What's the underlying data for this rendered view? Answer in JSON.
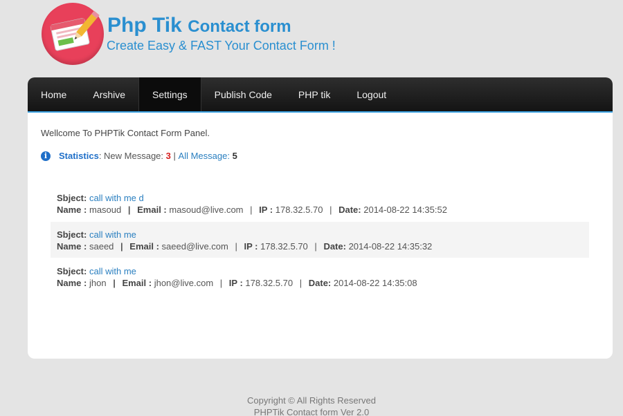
{
  "brand": {
    "title_main": "Php Tik",
    "title_rest": "Contact form",
    "subtitle": "Create Easy & FAST Your Contact Form !"
  },
  "nav": {
    "items": [
      {
        "label": "Home"
      },
      {
        "label": "Arshive"
      },
      {
        "label": "Settings",
        "active": true
      },
      {
        "label": "Publish Code"
      },
      {
        "label": "PHP tik"
      },
      {
        "label": "Logout"
      }
    ]
  },
  "welcome": "Wellcome To PHPTik Contact Form Panel.",
  "stats": {
    "label": "Statistics",
    "new_label": "New Message:",
    "new_count": "3",
    "separator": "|",
    "all_label": "All Message:",
    "all_count": "5"
  },
  "labels": {
    "subject": "Sbject:",
    "name": "Name :",
    "email": "Email :",
    "ip": "IP :",
    "date": "Date:",
    "sep": "|"
  },
  "messages": [
    {
      "subject": "call with me d",
      "name": "masoud",
      "email": "masoud@live.com",
      "ip": "178.32.5.70",
      "date": "2014-08-22 14:35:52"
    },
    {
      "subject": "call with me",
      "name": "saeed",
      "email": "saeed@live.com",
      "ip": "178.32.5.70",
      "date": "2014-08-22 14:35:32"
    },
    {
      "subject": "call with me",
      "name": "jhon",
      "email": "jhon@live.com",
      "ip": "178.32.5.70",
      "date": "2014-08-22 14:35:08"
    }
  ],
  "footer": {
    "line1": "Copyright © All Rights Reserved",
    "line2": "PHPTik Contact form Ver 2.0"
  },
  "colors": {
    "brand_blue": "#2a8fd0",
    "logo_red": "#e8405a",
    "nav_accent": "#3aa0e0",
    "new_count": "#d62020"
  }
}
